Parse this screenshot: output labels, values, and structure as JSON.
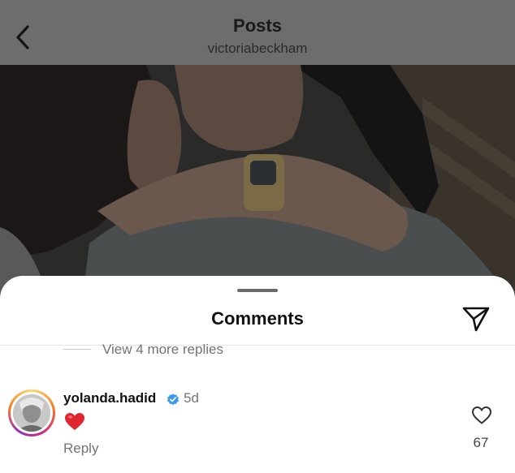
{
  "header": {
    "title": "Posts",
    "subtitle": "victoriabeckham"
  },
  "sheet": {
    "title": "Comments",
    "view_more": "View 4 more replies"
  },
  "comment": {
    "username": "yolanda.hadid",
    "time": "5d",
    "body_emoji": "red-heart",
    "reply_label": "Reply",
    "like_count": "67"
  },
  "colors": {
    "verified": "#3897f0",
    "heart": "#e0262f"
  }
}
